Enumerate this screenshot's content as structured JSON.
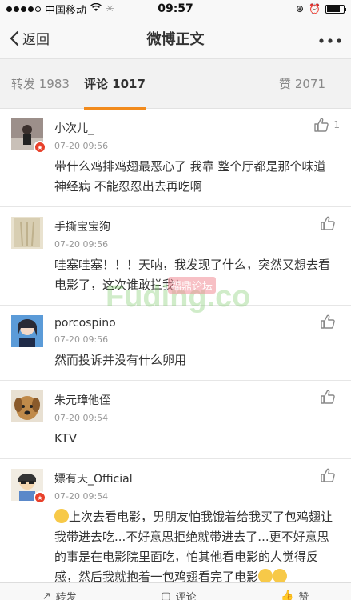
{
  "status": {
    "carrier": "中国移动",
    "time": "09:57"
  },
  "nav": {
    "back_label": "返回",
    "title": "微博正文"
  },
  "tabs": {
    "repost": "转发 1983",
    "comments": "评论 1017",
    "likes": "赞 2071"
  },
  "comments": [
    {
      "name": "小次儿_",
      "time": "07-20 09:56",
      "text": "带什么鸡排鸡翅最恶心了 我靠 整个厅都是那个味道 神经病 不能忍忍出去再吃啊",
      "likes": "1"
    },
    {
      "name": "手撕宝宝狗",
      "time": "07-20 09:56",
      "text": "哇塞哇塞！！！天呐，我发现了什么，突然又想去看电影了，这次谁敢拦我！",
      "likes": ""
    },
    {
      "name": "porcospino",
      "time": "07-20 09:56",
      "text": "然而投诉并没有什么卵用",
      "likes": ""
    },
    {
      "name": "朱元璋他侄",
      "time": "07-20 09:54",
      "text": "KTV",
      "likes": ""
    },
    {
      "name": "嫖有天_Official",
      "time": "07-20 09:54",
      "text": "上次去看电影，男朋友怕我饿着给我买了包鸡翅让我带进去吃...不好意思拒绝就带进去了...更不好意思的事是在电影院里面吃，怕其他看电影的人觉得反感，然后我就抱着一包鸡翅看完了电影",
      "likes": ""
    }
  ],
  "watermark": {
    "main": "Fuding.co",
    "badge": "福鼎论坛"
  },
  "bottom": {
    "repost": "转发",
    "comment": "评论",
    "like": "赞"
  },
  "colors": {
    "accent": "#f28b1d",
    "vip_badge": "#e8402a"
  }
}
